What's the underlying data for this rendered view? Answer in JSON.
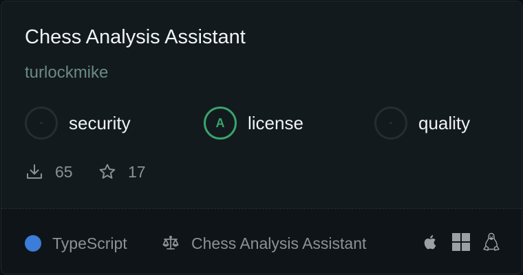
{
  "card": {
    "title": "Chess Analysis Assistant",
    "author": "turlockmike"
  },
  "grades": [
    {
      "label": "security",
      "grade": "-",
      "graded": false
    },
    {
      "label": "license",
      "grade": "A",
      "graded": true
    },
    {
      "label": "quality",
      "grade": "-",
      "graded": false
    }
  ],
  "stats": {
    "downloads": "65",
    "stars": "17",
    "downloads_icon": "download-icon",
    "stars_icon": "star-icon"
  },
  "footer": {
    "language": "TypeScript",
    "language_color": "#3b7dd8",
    "license_icon": "scale-icon",
    "license_name": "Chess Analysis Assistant",
    "platforms": [
      "apple-icon",
      "windows-icon",
      "linux-icon"
    ]
  },
  "colors": {
    "accent_green": "#3aa36c",
    "text_primary": "#f1f3f4",
    "text_muted": "#8b9296",
    "author_color": "#6b8b82"
  }
}
